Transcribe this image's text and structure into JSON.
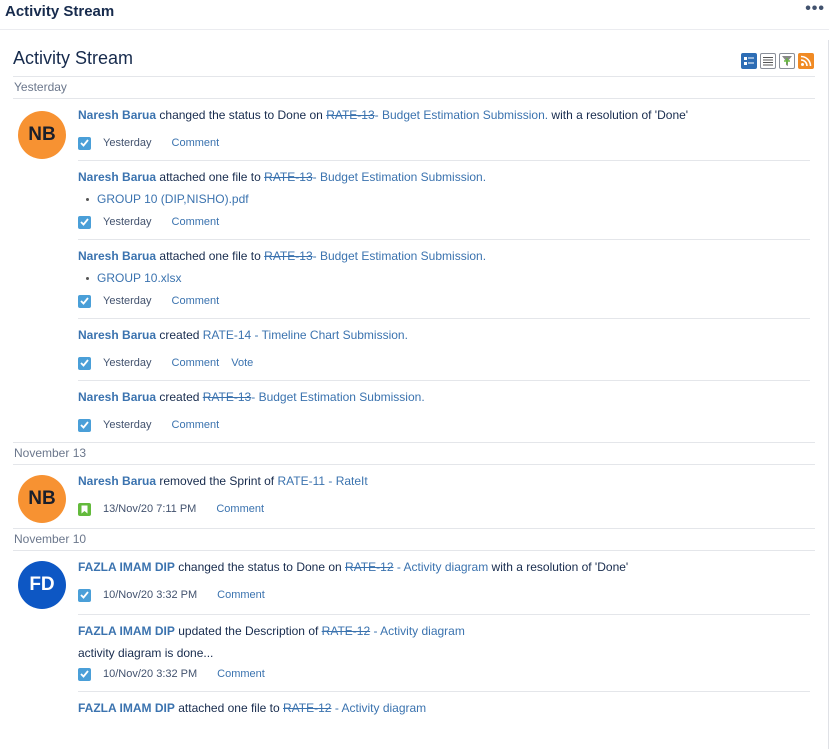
{
  "header": {
    "title": "Activity Stream",
    "more": "•••"
  },
  "gadget": {
    "title": "Activity Stream"
  },
  "days": {
    "yesterday": "Yesterday",
    "nov13": "November 13",
    "nov10": "November 10"
  },
  "avatars": {
    "nb": "NB",
    "fd": "FD"
  },
  "colors": {
    "link": "#3b73af",
    "nb_avatar": "#f79232",
    "fd_avatar": "#0d57c4",
    "task": "#4a9fd8",
    "story": "#63ba3c",
    "rss": "#f08a24"
  },
  "entries": [
    {
      "user": "Naresh Barua",
      "verb": "changed the status to Done on",
      "key": "RATE-13",
      "summary": "- Budget Estimation Submission.",
      "tail": "with a resolution of 'Done'",
      "time": "Yesterday",
      "comment": "Comment"
    },
    {
      "user": "Naresh Barua",
      "verb": "attached one file to",
      "key": "RATE-13",
      "summary": "- Budget Estimation Submission.",
      "file": "GROUP 10 (DIP,NISHO).pdf",
      "time": "Yesterday",
      "comment": "Comment"
    },
    {
      "user": "Naresh Barua",
      "verb": "attached one file to",
      "key": "RATE-13",
      "summary": "- Budget Estimation Submission.",
      "file": "GROUP 10.xlsx",
      "time": "Yesterday",
      "comment": "Comment"
    },
    {
      "user": "Naresh Barua",
      "verb": "created",
      "issue": "RATE-14 - Timeline Chart Submission.",
      "time": "Yesterday",
      "comment": "Comment",
      "vote": "Vote"
    },
    {
      "user": "Naresh Barua",
      "verb": "created",
      "key": "RATE-13",
      "summary": "- Budget Estimation Submission.",
      "time": "Yesterday",
      "comment": "Comment"
    },
    {
      "user": "Naresh Barua",
      "verb": "removed the Sprint of",
      "issue": "RATE-11 - RateIt",
      "time": "13/Nov/20 7:11 PM",
      "comment": "Comment"
    },
    {
      "user": "FAZLA IMAM DIP",
      "verb": "changed the status to Done on",
      "key": "RATE-12",
      "summary": "- Activity diagram",
      "tail": "with a resolution of 'Done'",
      "time": "10/Nov/20 3:32 PM",
      "comment": "Comment"
    },
    {
      "user": "FAZLA IMAM DIP",
      "verb": "updated the Description of",
      "key": "RATE-12",
      "summary": "- Activity diagram",
      "desc": "activity diagram is done...",
      "time": "10/Nov/20 3:32 PM",
      "comment": "Comment"
    },
    {
      "user": "FAZLA IMAM DIP",
      "verb": "attached one file to",
      "key": "RATE-12",
      "summary": "- Activity diagram"
    }
  ],
  "icons": [
    "full-view-icon",
    "list-view-icon",
    "filter-icon",
    "rss-icon",
    "task-checkbox-icon",
    "story-icon"
  ]
}
